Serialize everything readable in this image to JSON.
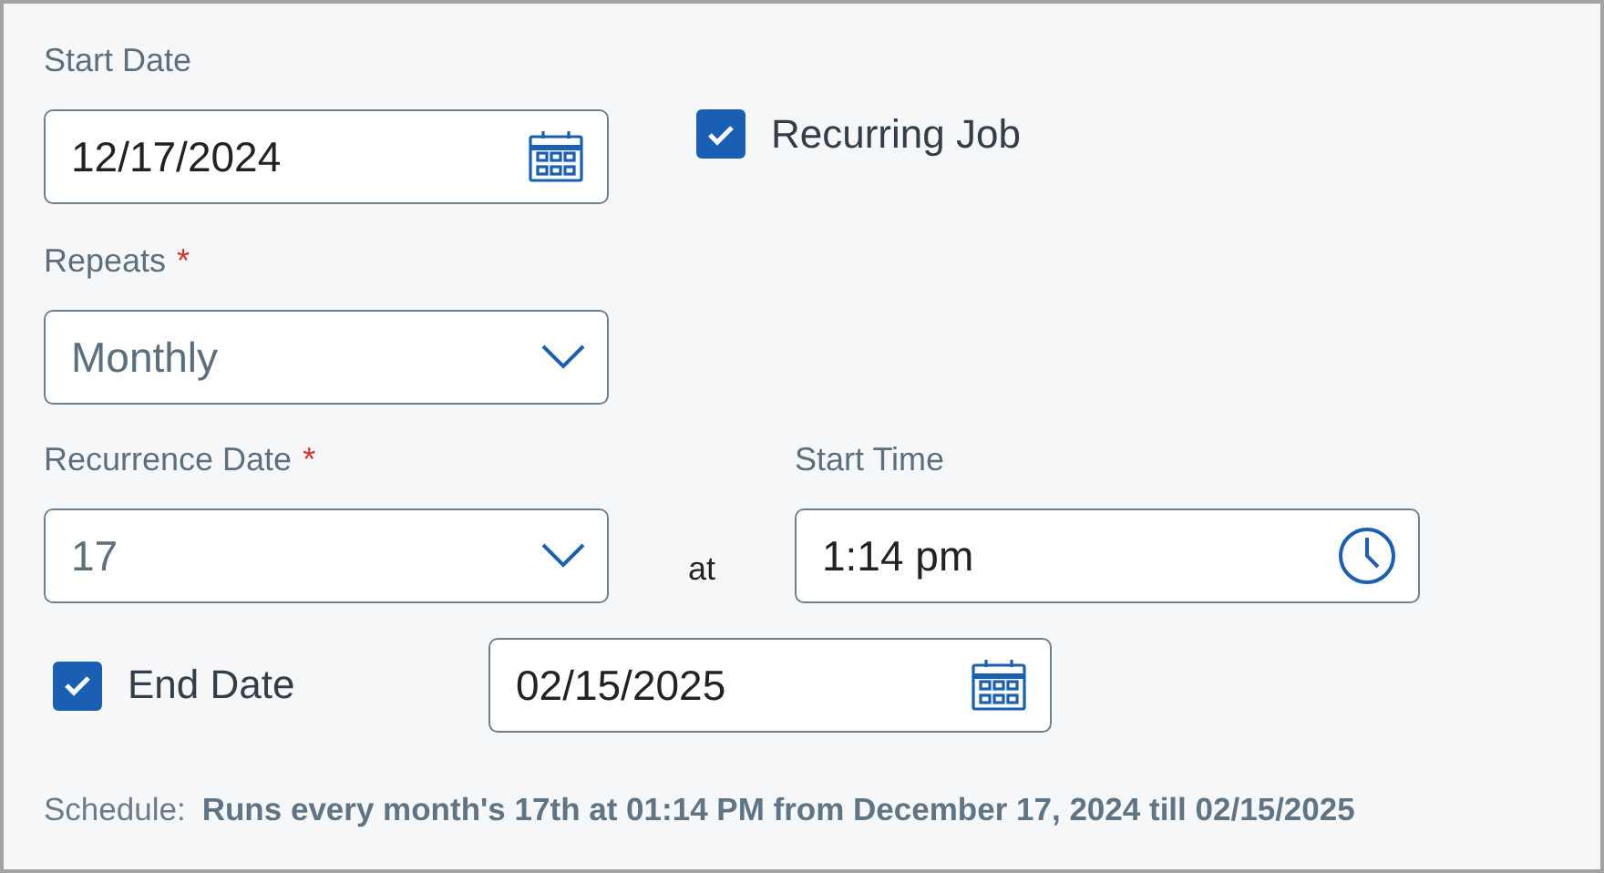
{
  "start_date": {
    "label": "Start Date",
    "value": "12/17/2024"
  },
  "recurring_job": {
    "label": "Recurring Job",
    "checked": true
  },
  "repeats": {
    "label": "Repeats",
    "required_mark": "*",
    "value": "Monthly"
  },
  "recurrence_date": {
    "label": "Recurrence Date",
    "required_mark": "*",
    "value": "17"
  },
  "at_label": "at",
  "start_time": {
    "label": "Start Time",
    "value": "1:14 pm"
  },
  "end_date": {
    "label": "End Date",
    "checked": true,
    "value": "02/15/2025"
  },
  "schedule": {
    "label": "Schedule:",
    "text": "Runs every month's 17th at 01:14 PM from December 17, 2024 till 02/15/2025"
  }
}
